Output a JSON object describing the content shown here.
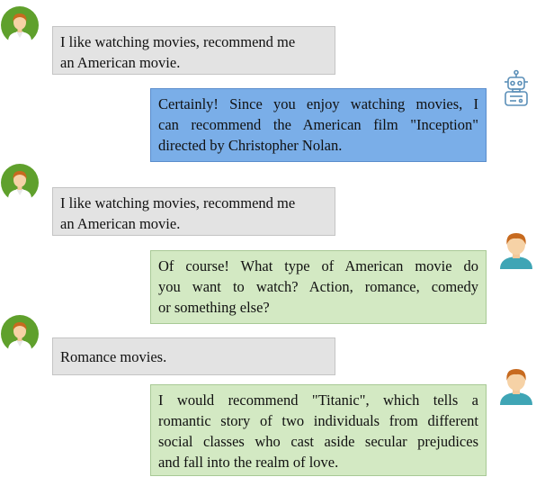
{
  "colors": {
    "user_bubble": "#e3e3e3",
    "robot_bubble": "#7aaee8",
    "human_agent_bubble": "#d3e9c3",
    "avatar_face_green_bg": "#5fa02c",
    "avatar_hair": "#c76a1f",
    "avatar_shirt": "#3fa5b5"
  },
  "messages": [
    {
      "speaker": "user",
      "avatar_icon": "user-avatar-icon",
      "lines": [
        "I like watching movies, recommend me",
        "an American movie."
      ]
    },
    {
      "speaker": "robot",
      "avatar_icon": "robot-avatar-icon",
      "lines": [
        "Certainly! Since you enjoy watching movies, I",
        "can recommend the American film \"Inception\"",
        "directed by Christopher Nolan."
      ]
    },
    {
      "speaker": "user",
      "avatar_icon": "user-avatar-icon",
      "lines": [
        "I like watching movies, recommend me",
        "an American movie."
      ]
    },
    {
      "speaker": "human_agent",
      "avatar_icon": "person-avatar-icon",
      "lines": [
        "Of course! What type of American movie do",
        "you want to watch? Action, romance, comedy",
        "or something else?"
      ]
    },
    {
      "speaker": "user",
      "avatar_icon": "user-avatar-icon",
      "lines": [
        "Romance movies."
      ]
    },
    {
      "speaker": "human_agent",
      "avatar_icon": "person-avatar-icon",
      "lines": [
        "I would recommend \"Titanic\", which tells a",
        "romantic story of two individuals from different",
        "social classes who cast aside secular prejudices",
        "and fall into the realm of love."
      ]
    }
  ]
}
